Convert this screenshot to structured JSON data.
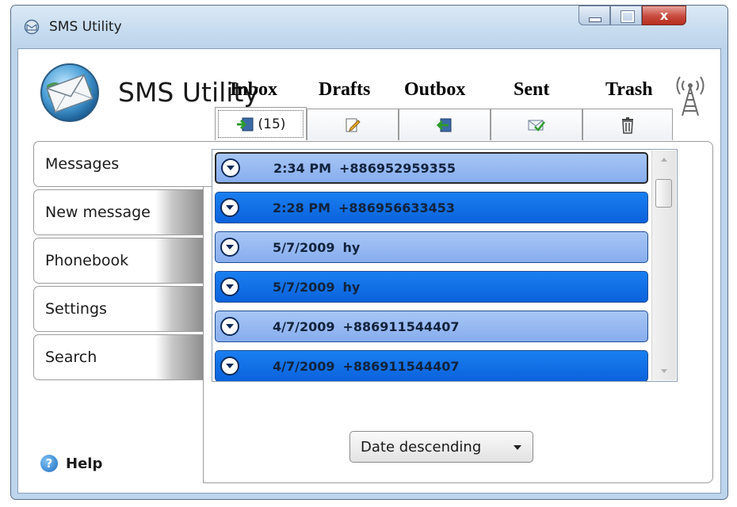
{
  "window": {
    "title": "SMS Utility",
    "controls": {
      "close_glyph": "x"
    }
  },
  "header": {
    "app_title": "SMS Utility",
    "logo_icon": "envelope-globe-icon",
    "signal_icon": "antenna-tower-icon"
  },
  "sidebar": {
    "items": [
      {
        "label": "Messages",
        "active": true
      },
      {
        "label": "New message",
        "active": false
      },
      {
        "label": "Phonebook",
        "active": false
      },
      {
        "label": "Settings",
        "active": false
      },
      {
        "label": "Search",
        "active": false
      }
    ],
    "help_label": "Help"
  },
  "folders": {
    "captions": {
      "inbox": "Inbox",
      "drafts": "Drafts",
      "outbox": "Outbox",
      "sent": "Sent",
      "trash": "Trash"
    },
    "inbox_count": "(15)",
    "active": "inbox"
  },
  "messages": [
    {
      "date": "2:34 PM",
      "contact": "+886952959355",
      "style": "light",
      "selected": true
    },
    {
      "date": "2:28 PM",
      "contact": "+886956633453",
      "style": "dark",
      "selected": false
    },
    {
      "date": "5/7/2009",
      "contact": "hy",
      "style": "light",
      "selected": false
    },
    {
      "date": "5/7/2009",
      "contact": "hy",
      "style": "dark",
      "selected": false
    },
    {
      "date": "4/7/2009",
      "contact": "+886911544407",
      "style": "light",
      "selected": false
    },
    {
      "date": "4/7/2009",
      "contact": "+886911544407",
      "style": "dark",
      "selected": false
    }
  ],
  "sort": {
    "selected": "Date descending"
  },
  "colors": {
    "row_light": "#94b8f2",
    "row_dark": "#0f6ee6",
    "frame": "#bcd4ec"
  }
}
